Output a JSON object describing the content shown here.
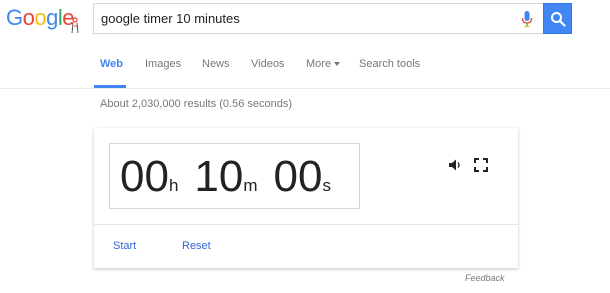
{
  "logo": {
    "text": "Google",
    "letters": [
      "G",
      "o",
      "o",
      "g",
      "l",
      "e"
    ],
    "colors": [
      "#4285f4",
      "#ea4335",
      "#fbbc05",
      "#4285f4",
      "#34a853",
      "#ea4335"
    ]
  },
  "search": {
    "query": "google timer 10 minutes"
  },
  "tabs": [
    {
      "label": "Web",
      "active": true
    },
    {
      "label": "Images",
      "active": false
    },
    {
      "label": "News",
      "active": false
    },
    {
      "label": "Videos",
      "active": false
    },
    {
      "label": "More",
      "active": false
    },
    {
      "label": "Search tools",
      "active": false
    }
  ],
  "results_stats": "About 2,030,000 results (0.56 seconds)",
  "timer": {
    "hours": "00",
    "hours_unit": "h",
    "minutes": "10",
    "minutes_unit": "m",
    "seconds": "00",
    "seconds_unit": "s"
  },
  "actions": {
    "start": "Start",
    "reset": "Reset"
  },
  "feedback": "Feedback",
  "colors": {
    "accent": "#4285f4",
    "link": "#3367d6"
  }
}
